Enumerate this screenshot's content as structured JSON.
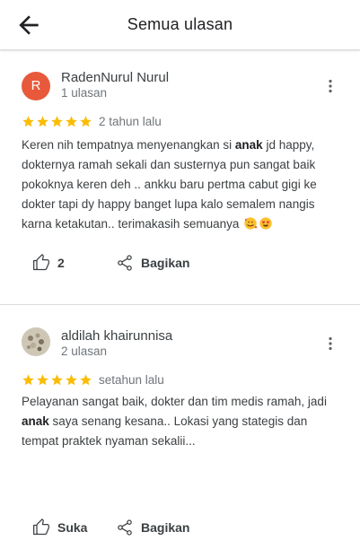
{
  "header": {
    "title": "Semua ulasan"
  },
  "reviews": [
    {
      "avatar_letter": "R",
      "author": "RadenNurul Nurul",
      "author_reviews": "1 ulasan",
      "rating": 5,
      "date": "2 tahun lalu",
      "text_parts": [
        "Keren nih tempatnya menyenangkan si ",
        "anak",
        " jd happy, dokternya ramah sekali dan susternya pun sangat baik pokoknya keren deh .. ankku baru pertma cabut gigi ke dokter tapi dy happy banget lupa kalo semalem nangis karna ketakutan.. terimakasih semuanya "
      ],
      "emojis": [
        "smiling-face-with-hearts",
        "heart-eyes"
      ],
      "like_label": "2",
      "share_label": "Bagikan"
    },
    {
      "author": "aldilah khairunnisa",
      "author_reviews": "2 ulasan",
      "rating": 5,
      "date": "setahun lalu",
      "text_parts": [
        "Pelayanan sangat baik, dokter dan tim medis ramah, jadi ",
        "anak",
        " saya senang kesana.. Lokasi yang stategis dan tempat praktek nyaman sekalii..."
      ],
      "like_label": "Suka",
      "share_label": "Bagikan"
    }
  ],
  "colors": {
    "star": "#fbbc04",
    "avatar_r": "#e8593b",
    "divider": "#dadce0"
  }
}
